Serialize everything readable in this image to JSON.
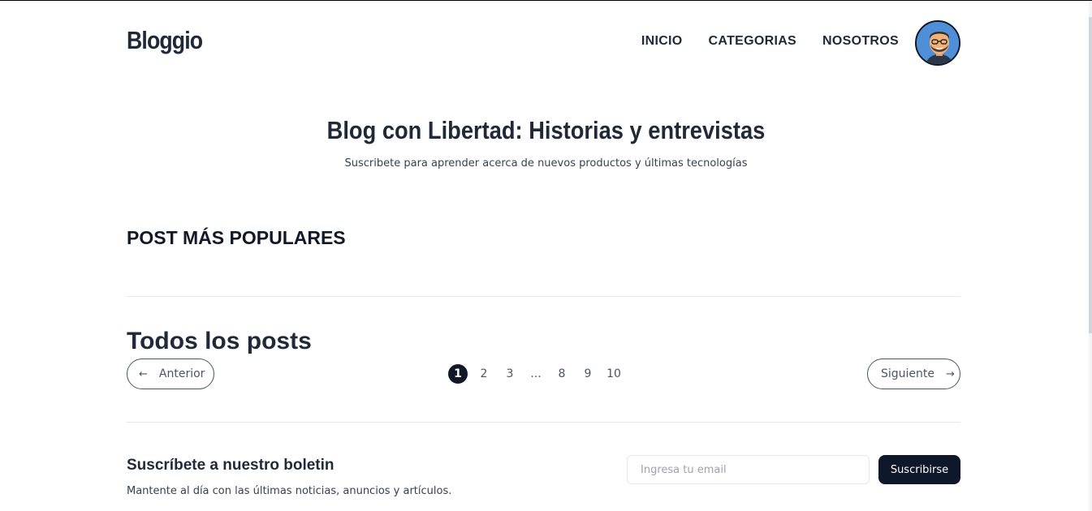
{
  "header": {
    "logo": "Bloggio",
    "nav": [
      "INICIO",
      "CATEGORIAS",
      "NOSOTROS"
    ]
  },
  "hero": {
    "title": "Blog con Libertad: Historias y entrevistas",
    "subtitle": "Suscribete para aprender acerca de nuevos productos y últimas tecnologías"
  },
  "popular": {
    "heading": "POST MÁS POPULARES"
  },
  "all_posts": {
    "heading": "Todos los posts",
    "prev_label": "Anterior",
    "next_label": "Siguiente",
    "pages": [
      "1",
      "2",
      "3",
      "...",
      "8",
      "9",
      "10"
    ],
    "active_page": "1"
  },
  "newsletter": {
    "title": "Suscríbete a nuestro boletin",
    "description": "Mantente al día con las últimas noticias, anuncios y artículos.",
    "email_placeholder": "Ingresa tu email",
    "button_label": "Suscribirse"
  },
  "colors": {
    "text_dark": "#1f2937",
    "button_dark": "#0f172a",
    "avatar_bg": "#4f8fd8"
  },
  "icons": {
    "prev": "arrow-left-icon",
    "next": "arrow-right-icon"
  }
}
